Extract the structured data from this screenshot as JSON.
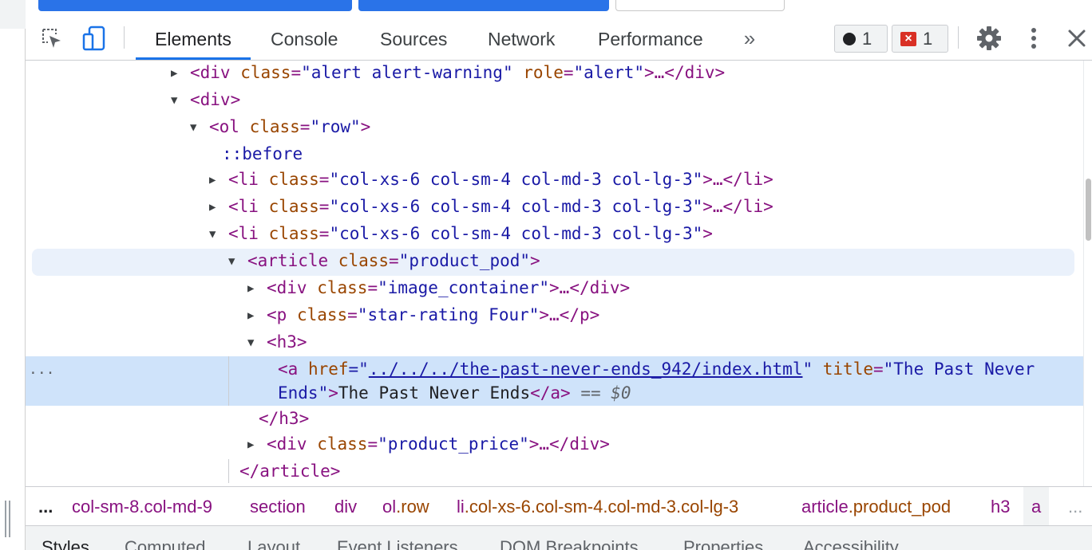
{
  "toolbar": {
    "tabs": [
      "Elements",
      "Console",
      "Sources",
      "Network",
      "Performance"
    ],
    "more_tabs": "»",
    "info_count": "1",
    "error_count": "1"
  },
  "tree": {
    "l1": {
      "open": "<div ",
      "attr1": "class",
      "val1": "\"alert alert-warning\"",
      "attr2": "role",
      "val2": "\"alert\"",
      "rest": ">…</div>"
    },
    "l2": {
      "tag": "<div>"
    },
    "l3": {
      "open": "<ol ",
      "attr": "class",
      "val": "\"row\"",
      "close": ">"
    },
    "l4": {
      "pseudo": "::before"
    },
    "l5": {
      "open": "<li ",
      "attr": "class",
      "val": "\"col-xs-6 col-sm-4 col-md-3 col-lg-3\"",
      "rest": ">…</li>"
    },
    "l6": {
      "open": "<li ",
      "attr": "class",
      "val": "\"col-xs-6 col-sm-4 col-md-3 col-lg-3\"",
      "rest": ">…</li>"
    },
    "l7": {
      "open": "<li ",
      "attr": "class",
      "val": "\"col-xs-6 col-sm-4 col-md-3 col-lg-3\"",
      "close": ">"
    },
    "l8": {
      "open": "<article ",
      "attr": "class",
      "val": "\"product_pod\"",
      "close": ">"
    },
    "l9": {
      "open": "<div ",
      "attr": "class",
      "val": "\"image_container\"",
      "rest": ">…</div>"
    },
    "l10": {
      "open": "<p ",
      "attr": "class",
      "val": "\"star-rating Four\"",
      "rest": ">…</p>"
    },
    "l11": {
      "tag": "<h3>"
    },
    "l12": {
      "open": "<a ",
      "attr1": "href",
      "q1": "=\"",
      "href": "../../../the-past-never-ends_942/index.html",
      "q2": "\" ",
      "attr2": "title",
      "val2": "\"The Past Never"
    },
    "l13": {
      "val2b": "Ends\"",
      "gt": ">",
      "text": "The Past Never Ends",
      "close": "</a>",
      "eq": " == ",
      "sval": "$0"
    },
    "l14": {
      "tag": "</h3>"
    },
    "l15": {
      "open": "<div ",
      "attr": "class",
      "val": "\"product_price\"",
      "rest": ">…</div>"
    },
    "l16": {
      "tag": "</article>"
    },
    "sel_ellipsis": "..."
  },
  "breadcrumb": {
    "leading_ellipsis": "...",
    "items": [
      {
        "tag": "col-sm-8.col-md-9",
        "cls": ""
      },
      {
        "tag": "section",
        "cls": ""
      },
      {
        "tag": "div",
        "cls": ""
      },
      {
        "tag": "ol",
        "cls": ".row"
      },
      {
        "tag": "li",
        "cls": ".col-xs-6.col-sm-4.col-md-3.col-lg-3"
      },
      {
        "tag": "article",
        "cls": ".product_pod"
      },
      {
        "tag": "h3",
        "cls": ""
      },
      {
        "tag": "a",
        "cls": ""
      }
    ],
    "trailing_ellipsis": "..."
  },
  "subtabs": [
    "Styles",
    "Computed",
    "Layout",
    "Event Listeners",
    "DOM Breakpoints",
    "Properties",
    "Accessibility"
  ]
}
